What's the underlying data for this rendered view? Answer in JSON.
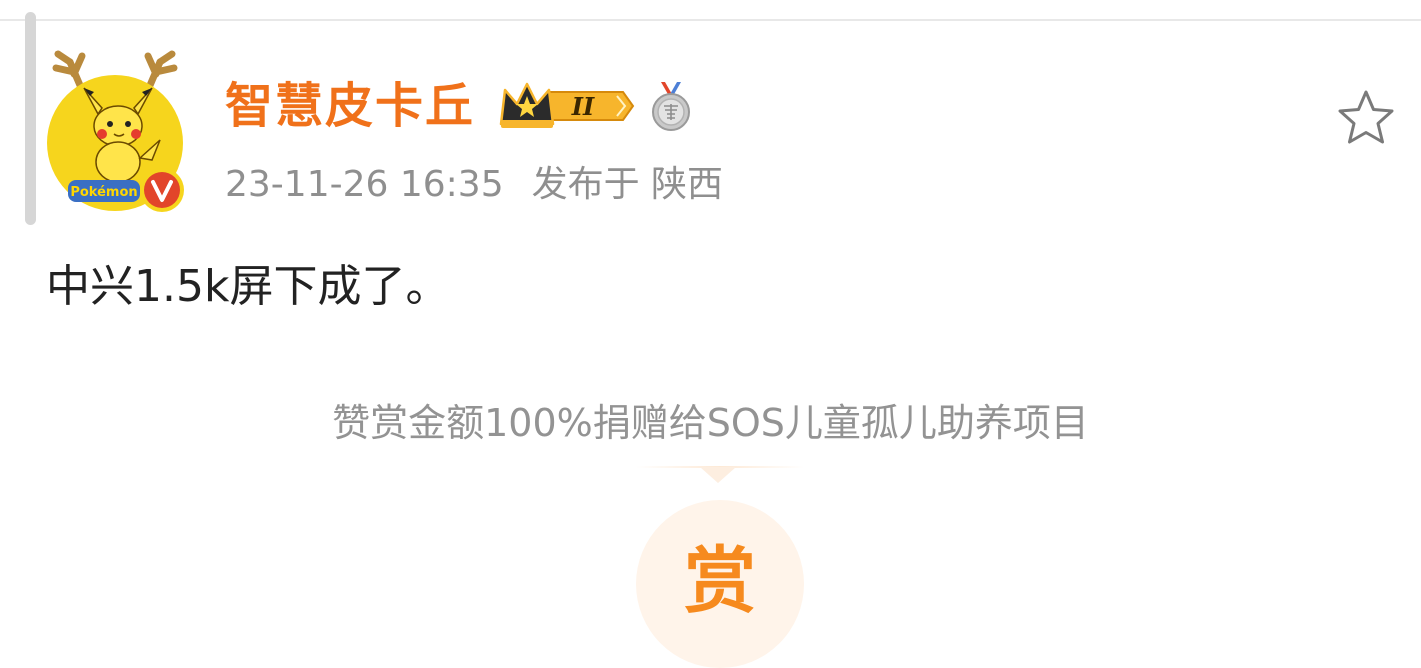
{
  "user": {
    "name": "智慧皮卡丘",
    "avatar_text": "Pokémon",
    "verified_mark": "V",
    "level_badge": "II"
  },
  "post": {
    "timestamp": "23-11-26 16:35",
    "location": "发布于 陕西",
    "text": "中兴1.5k屏下成了。"
  },
  "reward": {
    "note": "赞赏金额100%捐赠给SOS儿童孤儿助养项目",
    "button_label": "赏"
  },
  "icons": {
    "favorite": "star-outline-icon",
    "crown": "crown-icon",
    "medal": "medal-icon"
  },
  "colors": {
    "username": "#f0711a",
    "meta": "#8f8f8f",
    "reward_accent": "#f68a1e",
    "reward_bg": "#fff4ea"
  }
}
